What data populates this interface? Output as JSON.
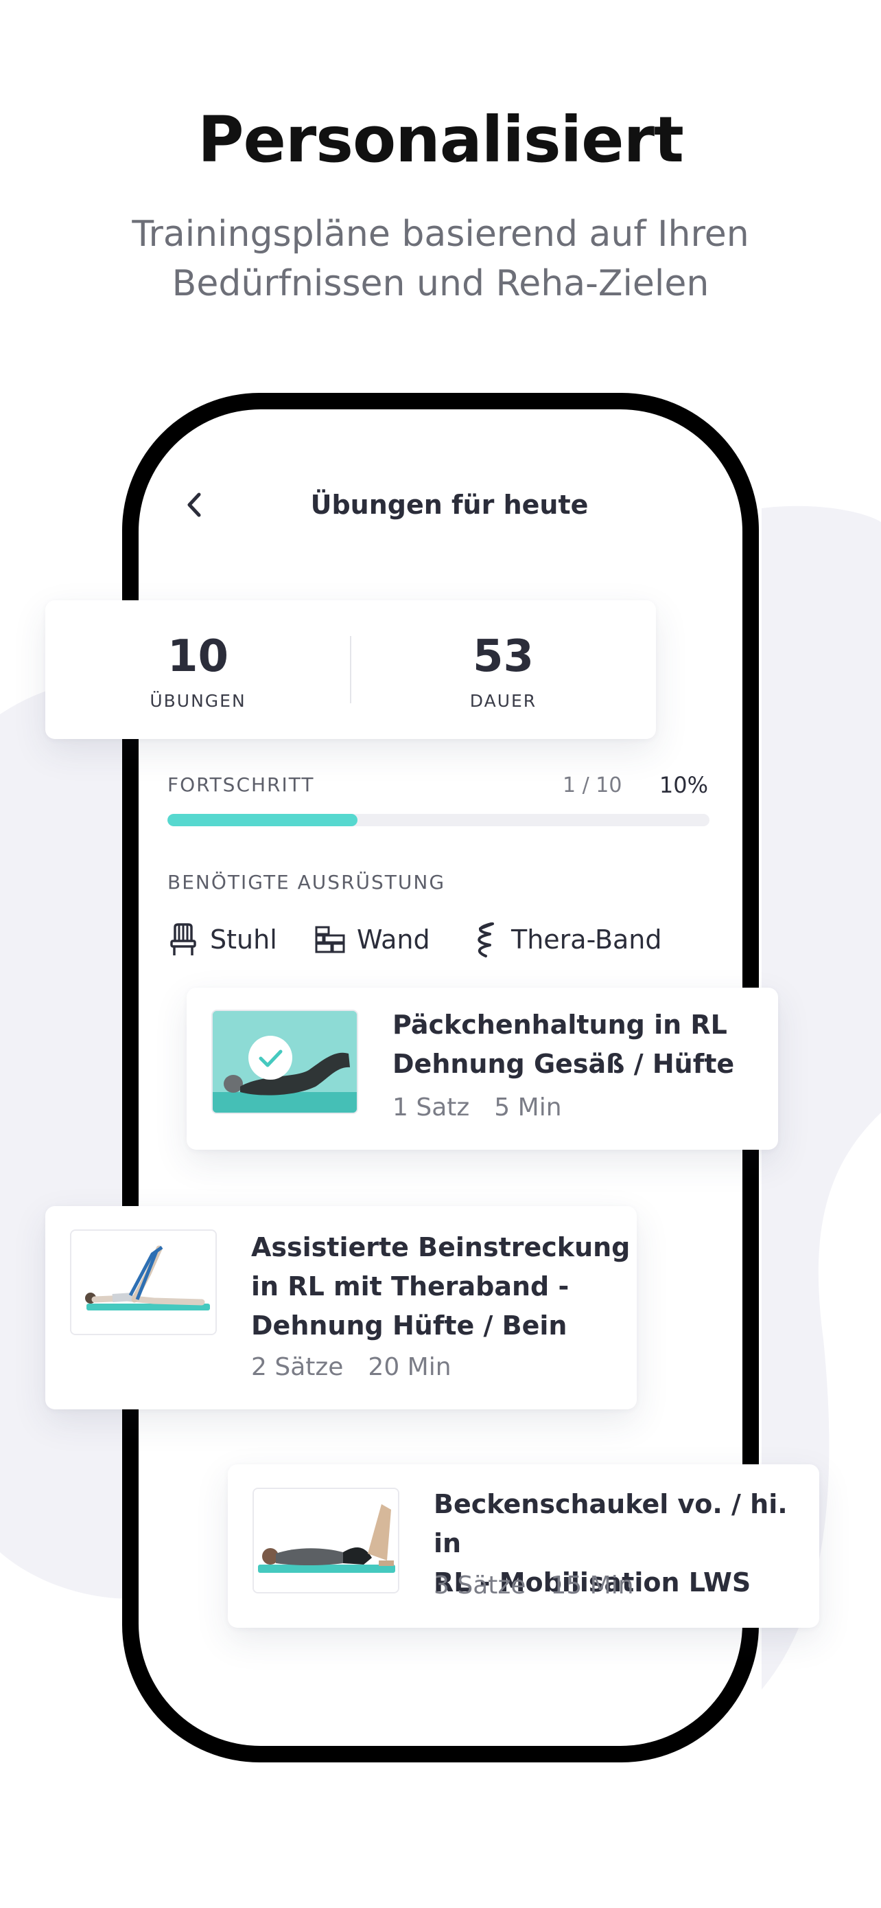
{
  "headline": "Personalisiert",
  "subline_1": "Trainingspläne basierend auf Ihren",
  "subline_2": "Bedürfnissen und Reha-Zielen",
  "screen": {
    "title": "Übungen für heute",
    "back_icon": "chevron-left-icon"
  },
  "stats": {
    "exercises_value": "10",
    "exercises_label": "ÜBUNGEN",
    "duration_value": "53",
    "duration_label": "DAUER"
  },
  "progress": {
    "label": "FORTSCHRITT",
    "count": "1 / 10",
    "percent_text": "10%",
    "fill_fraction": 0.35
  },
  "equipment": {
    "label": "BENÖTIGTE AUSRÜSTUNG",
    "items": [
      {
        "label": "Stuhl",
        "icon": "chair-icon"
      },
      {
        "label": "Wand",
        "icon": "wall-icon"
      },
      {
        "label": "Thera-Band",
        "icon": "band-icon"
      }
    ]
  },
  "exercises": [
    {
      "title_1": "Päckchenhaltung in RL",
      "title_2": "Dehnung Gesäß / Hüfte",
      "sets": "1 Satz",
      "duration": "5 Min",
      "completed": true
    },
    {
      "title_1": "Assistierte Beinstreckung",
      "title_2": "in RL mit Theraband -",
      "title_3": "Dehnung Hüfte / Bein",
      "sets": "2 Sätze",
      "duration": "20 Min",
      "completed": false
    },
    {
      "title_1": "Beckenschaukel vo. / hi. in",
      "title_2": "RL - Mobilisation LWS",
      "sets": "3 Sätze",
      "duration": "15 Min",
      "completed": false
    }
  ],
  "colors": {
    "accent": "#56d8cf",
    "background_blob": "#f2f2f7",
    "text_dark": "#2b2d3a",
    "text_muted": "#7a7c86"
  }
}
